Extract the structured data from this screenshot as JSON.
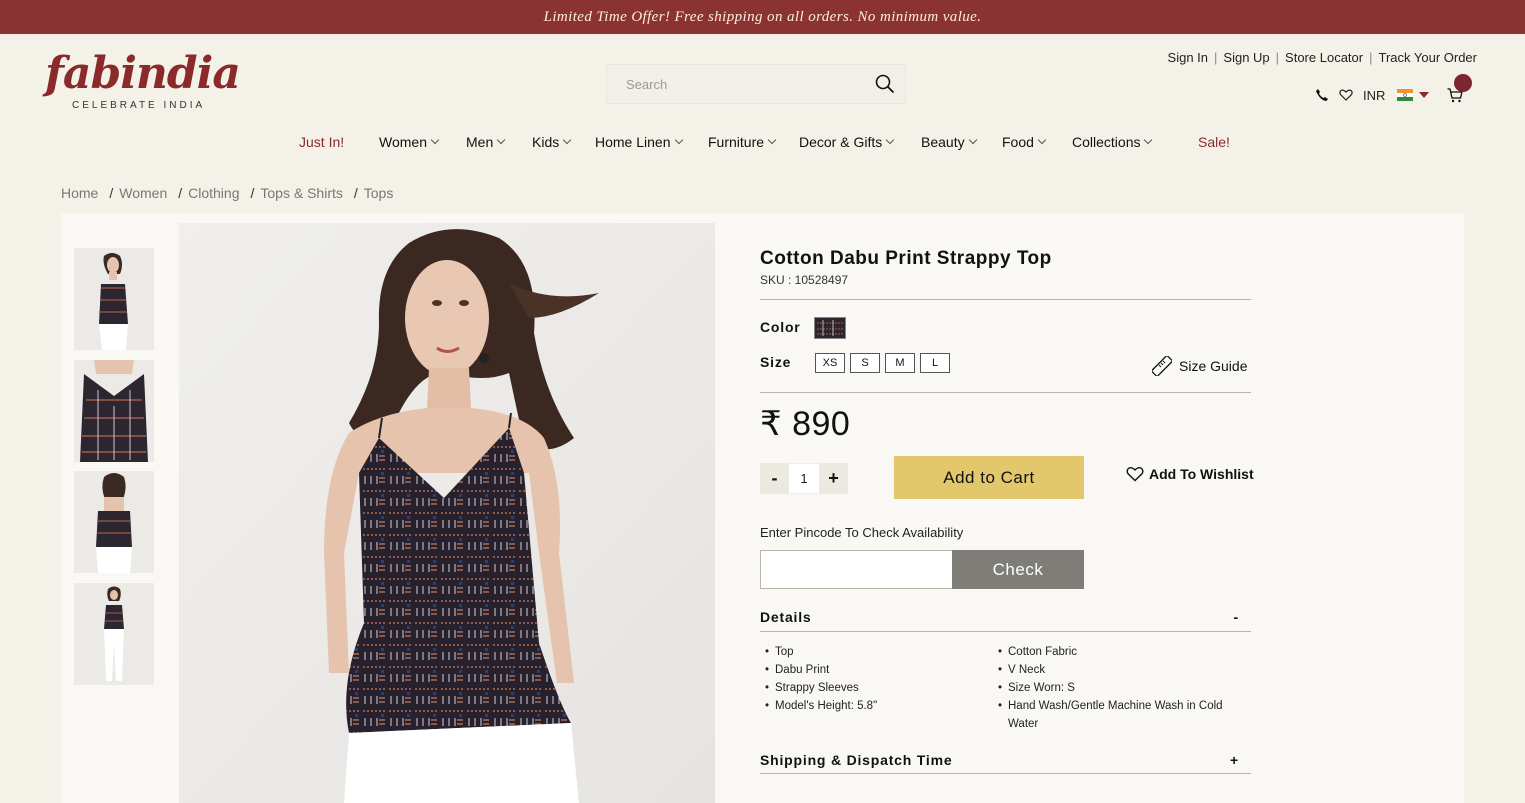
{
  "promo": "Limited Time Offer! Free shipping on all orders. No minimum value.",
  "brand": {
    "name": "fabindia",
    "tagline": "CELEBRATE INDIA",
    "color": "#8b2a2a"
  },
  "search": {
    "placeholder": "Search"
  },
  "top_links": [
    "Sign In",
    "Sign Up",
    "Store Locator",
    "Track Your Order"
  ],
  "utils": {
    "currency": "INR"
  },
  "nav": [
    {
      "label": "Just In!",
      "dropdown": false,
      "accent": true
    },
    {
      "label": "Women",
      "dropdown": true
    },
    {
      "label": "Men",
      "dropdown": true
    },
    {
      "label": "Kids",
      "dropdown": true
    },
    {
      "label": "Home Linen",
      "dropdown": true
    },
    {
      "label": "Furniture",
      "dropdown": true
    },
    {
      "label": "Decor & Gifts",
      "dropdown": true
    },
    {
      "label": "Beauty",
      "dropdown": true
    },
    {
      "label": "Food",
      "dropdown": true
    },
    {
      "label": "Collections",
      "dropdown": true
    },
    {
      "label": "Sale!",
      "dropdown": false,
      "accent": true
    }
  ],
  "breadcrumb": [
    "Home",
    "Women",
    "Clothing",
    "Tops & Shirts",
    "Tops"
  ],
  "product": {
    "title": "Cotton Dabu Print Strappy Top",
    "sku": "SKU : 10528497",
    "color_label": "Color",
    "size_label": "Size",
    "sizes": [
      "XS",
      "S",
      "M",
      "L"
    ],
    "size_guide": "Size Guide",
    "price": "₹ 890",
    "quantity": "1",
    "qty_minus": "-",
    "qty_plus": "+",
    "add_to_cart": "Add to Cart",
    "add_to_wishlist": "Add To Wishlist",
    "pincode_label": "Enter Pincode To Check Availability",
    "check": "Check",
    "details": {
      "title": "Details",
      "toggle": "-",
      "left": [
        "Top",
        "Dabu Print",
        "Strappy Sleeves",
        "Model's Height: 5.8\""
      ],
      "right": [
        "Cotton Fabric",
        "V Neck",
        "Size Worn: S",
        "Hand Wash/Gentle Machine Wash in Cold Water"
      ]
    },
    "shipping": {
      "title": "Shipping & Dispatch Time",
      "toggle": "+"
    }
  },
  "colors": {
    "promo_bar": "#8b3333",
    "add_to_cart": "#e3c76c",
    "check_button": "#7f7d78",
    "cart_badge": "#7d2630"
  }
}
